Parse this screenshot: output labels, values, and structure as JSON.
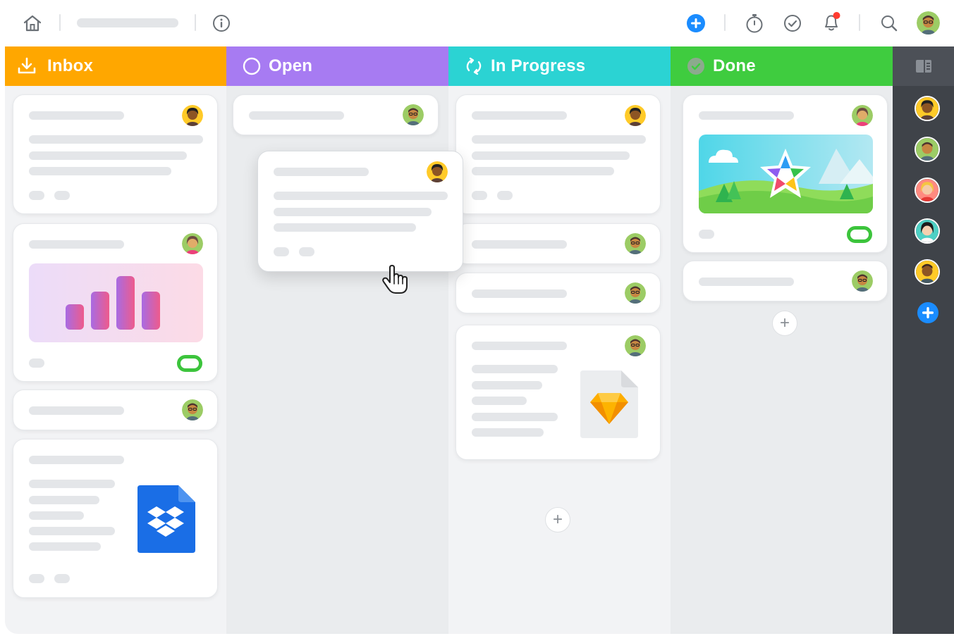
{
  "topbar": {
    "home_icon": "home-icon",
    "info_icon": "info-icon",
    "add_icon": "plus-circle-icon",
    "timer_icon": "stopwatch-icon",
    "check_icon": "check-circle-icon",
    "bell_icon": "bell-icon",
    "search_icon": "search-icon",
    "colors": {
      "add": "#1a8cff",
      "bell_dot": "#ff3b30",
      "icon": "#6b7177"
    }
  },
  "columns": [
    {
      "title": "Inbox",
      "icon": "download-tray-icon",
      "color": "#ffa700"
    },
    {
      "title": "Open",
      "icon": "circle-icon",
      "color": "#a77bf2"
    },
    {
      "title": "In Progress",
      "icon": "sync-arrows-icon",
      "color": "#2bd3d3"
    },
    {
      "title": "Done",
      "icon": "check-circle-filled-icon",
      "color": "#3fcc3f"
    }
  ],
  "sidebar": {
    "toggle_icon": "panel-toggle-icon",
    "add_icon": "plus-circle-icon",
    "colors": {
      "bg": "#3f4349",
      "head": "#4c5057"
    }
  },
  "attachments": {
    "chart_icon": "bar-chart-thumbnail",
    "image_icon": "landscape-star-thumbnail",
    "sketch_icon": "sketch-file-icon",
    "dropbox_icon": "dropbox-file-icon"
  },
  "cursor_icon": "hand-pointer-icon"
}
